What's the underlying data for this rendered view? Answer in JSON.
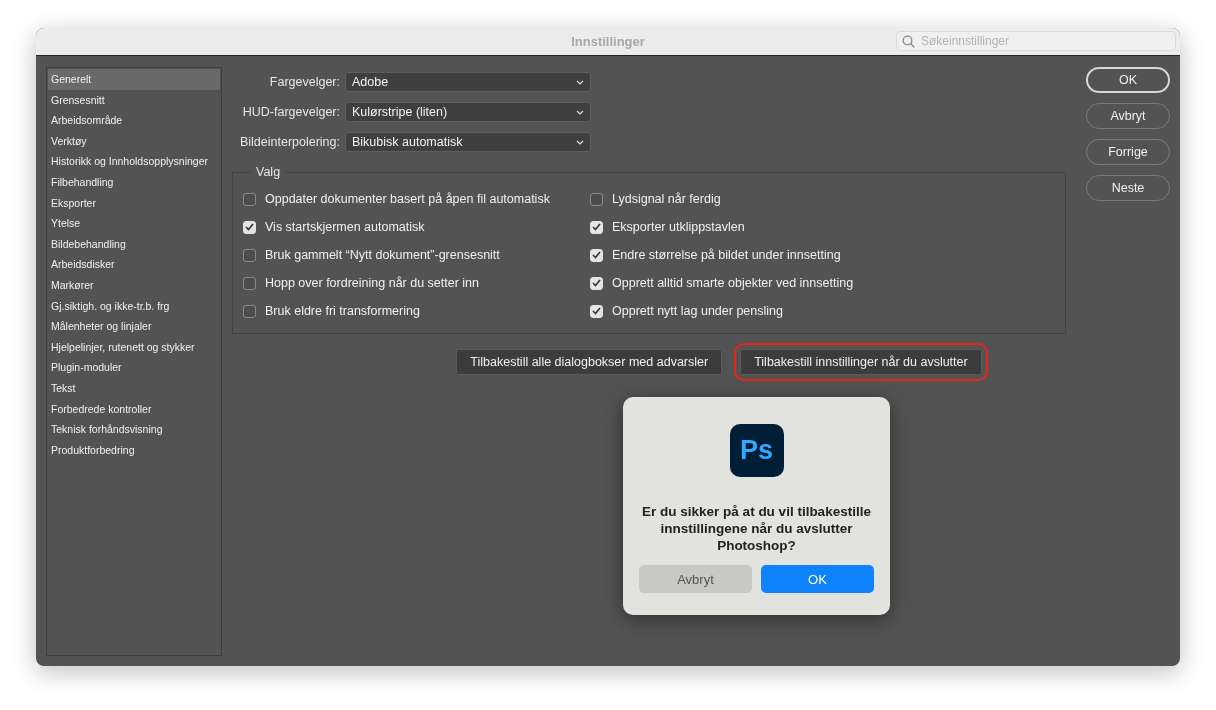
{
  "window": {
    "title": "Innstillinger"
  },
  "search": {
    "placeholder": "Søkeinnstillinger"
  },
  "sidebar": {
    "items": [
      {
        "label": "Generelt",
        "selected": true
      },
      {
        "label": "Grensesnitt",
        "selected": false
      },
      {
        "label": "Arbeidsområde",
        "selected": false
      },
      {
        "label": "Verktøy",
        "selected": false
      },
      {
        "label": "Historikk og Innholdsopplysninger",
        "selected": false
      },
      {
        "label": "Filbehandling",
        "selected": false
      },
      {
        "label": "Eksporter",
        "selected": false
      },
      {
        "label": "Ytelse",
        "selected": false
      },
      {
        "label": "Bildebehandling",
        "selected": false
      },
      {
        "label": "Arbeidsdisker",
        "selected": false
      },
      {
        "label": "Markører",
        "selected": false
      },
      {
        "label": "Gj.siktigh. og ikke-tr.b. frg",
        "selected": false
      },
      {
        "label": "Målenheter og linjaler",
        "selected": false
      },
      {
        "label": "Hjelpelinjer, rutenett og stykker",
        "selected": false
      },
      {
        "label": "Plugin-moduler",
        "selected": false
      },
      {
        "label": "Tekst",
        "selected": false
      },
      {
        "label": "Forbedrede kontroller",
        "selected": false
      },
      {
        "label": "Teknisk forhåndsvisning",
        "selected": false
      },
      {
        "label": "Produktforbedring",
        "selected": false
      }
    ]
  },
  "dropdowns": [
    {
      "label": "Fargevelger:",
      "value": "Adobe"
    },
    {
      "label": "HUD-fargevelger:",
      "value": "Kulørstripe (liten)"
    },
    {
      "label": "Bildeinterpolering:",
      "value": "Bikubisk automatisk"
    }
  ],
  "options_group": {
    "title": "Valg",
    "checkboxes": [
      {
        "label": "Oppdater dokumenter basert på åpen fil automatisk",
        "checked": false
      },
      {
        "label": "Lydsignal når ferdig",
        "checked": false
      },
      {
        "label": "Vis startskjermen automatisk",
        "checked": true
      },
      {
        "label": "Eksporter utklippstavlen",
        "checked": true
      },
      {
        "label": "Bruk gammelt “Nytt dokument”-grensesnitt",
        "checked": false
      },
      {
        "label": "Endre størrelse på bildet under innsetting",
        "checked": true
      },
      {
        "label": "Hopp over fordreining når du setter inn",
        "checked": false
      },
      {
        "label": "Opprett alltid smarte objekter ved innsetting",
        "checked": true
      },
      {
        "label": "Bruk eldre fri transformering",
        "checked": false
      },
      {
        "label": "Opprett nytt lag under pensling",
        "checked": true
      }
    ]
  },
  "reset_buttons": [
    {
      "label": "Tilbakestill alle dialogbokser med advarsler",
      "highlighted": false
    },
    {
      "label": "Tilbakestill innstillinger når du avslutter",
      "highlighted": true
    }
  ],
  "side_buttons": [
    "OK",
    "Avbryt",
    "Forrige",
    "Neste"
  ],
  "alert": {
    "app_logo": "Ps",
    "message": "Er du sikker på at du vil tilbakestille innstillingene når du avslutter Photoshop?",
    "buttons": [
      {
        "label": "Avbryt",
        "kind": "secondary"
      },
      {
        "label": "OK",
        "kind": "primary"
      }
    ]
  }
}
